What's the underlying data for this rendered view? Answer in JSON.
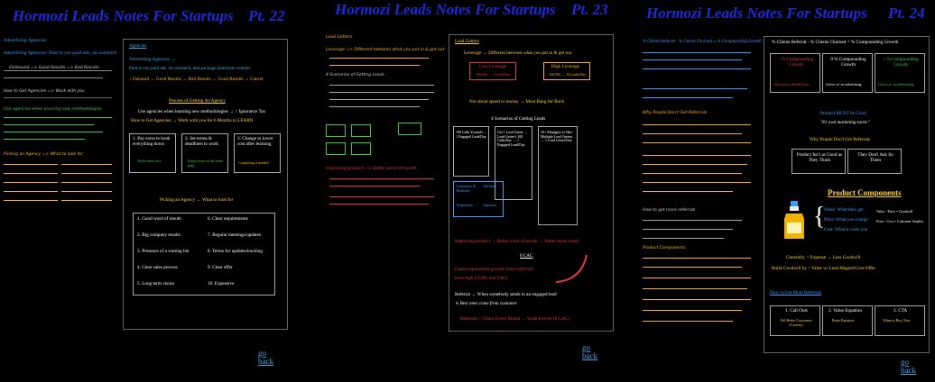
{
  "columns": [
    {
      "title": "Hormozi Leads Notes For Startups",
      "part": "Pt. 22",
      "go_back": "go back",
      "handwritten_notes": [
        "Advertising Agencies",
        "Advertising Agencies: Paid to run paid ads, do outreach",
        "Outbound => Good Results => Bad Results",
        "How to Get Agencies => Work with you",
        "Use agencies when learning new methodologies",
        "Picking an Agency => What to look for"
      ],
      "panel": {
        "heading": "Agencies",
        "lines": [
          "Advertising Agencies →",
          "Paid to run paid ads, do outreach, and package distribute content",
          "↓ Onboard → Good Results → Bad Results → Good Results → Cancel"
        ],
        "process_heading": "Process of Getting An Agency",
        "process_line1": "Use agencies when learning new methodologies → ↑ Ignorance Tax",
        "process_line2": "How to Get Agencies → Work with you for 6 Months to LEARN",
        "steps": [
          {
            "label": "1. Pay extra to book everything down",
            "sub": "Teach team once"
          },
          {
            "label": "2. Set terms & deadlines to work",
            "sub": "Keeps team on the same page"
          },
          {
            "label": "3. Change to lower cost after learning",
            "sub": "Consulting if needed"
          }
        ],
        "picking_line": "Picking an Agency → What to look for",
        "criteria": [
          "1. Good word of mouth",
          "6. Clear requirements",
          "2. Big company results",
          "7. Regular meetings/updates",
          "3. Presence of a waiting list",
          "8. Terms for updates/tracking",
          "4. Clear sales process",
          "9. Clear offer",
          "5. Long term vision",
          "10. Expensive"
        ]
      }
    },
    {
      "title": "Hormozi Leads Notes For Startups",
      "part": "Pt. 23",
      "go_back": "go back",
      "handwritten_notes": [
        "Lead Getters",
        "Leverage => Different between what you put in & get out",
        "4 Scenarios of Getting Leads",
        "Improving product => Better word of mouth"
      ],
      "panel": {
        "heading": "Lead Getters",
        "leverage_line": "Leverage → Different between what you put in & get out",
        "low_leverage": "Low Leverage",
        "low_leverage_sub": "1Hr/Wk → 1 Lead/Day",
        "high_leverage": "High Leverage",
        "high_leverage_sub": "1Hr/Wk → 1k Leads/Day",
        "not_about_line": "Not about speed or money → Most Bang for Buck",
        "scenarios_heading": "4 Scenarios of Getting Leads",
        "scenarios": [
          "100 Calls Yourself → 1 Engaged Lead/Day",
          "Get 1 Lead Getter → Lead Getter's 100 Calls/Day → 1 Engaged Lead/Day",
          "10+ Managers to Hire Multiple Lead Getters → 1 Lead Getter/Day"
        ],
        "affiliates": [
          "Customers & Referrals",
          "Affiliates",
          "Employees",
          "Agencies"
        ],
        "improving_line": "Improving product → Better word of mouth → Better more Leads",
        "cac_label": "0 CAC",
        "cause_line": "Cause exponential growth, since referrals",
        "cause_line2": "have high LTGPs and CACs",
        "referral_line": "Referral → When somebody sends in an engaged lead",
        "referral_sub": "↳ Best ones come from customer",
        "footer_line": "Referrals > Churn Every Month → Scale forever (0 CAC)"
      }
    },
    {
      "title": "Hormozi Leads Notes For Startups",
      "part": "Pt. 24",
      "go_back": "go back",
      "handwritten_notes": [
        "% Clients Referral - % Clients Churned = % Compounding Growth",
        "Why People Don't Get Referrals",
        "How to get more referrals",
        "Product Components"
      ],
      "panel": {
        "top_line": "% Clients Referral - % Clients Churned = % Compounding Growth",
        "growth_cells": [
          {
            "label": "- % Compounding Growth",
            "sub": "Advertise to Break Even",
            "color": "#e23b3b"
          },
          {
            "label": "0 % Compounding Growth",
            "sub": "Grows w/ no advertising",
            "color": "#ffffff"
          },
          {
            "label": "+ % Compounding Growth",
            "sub": "Grows w/ no advertising",
            "color": "#3ec93e"
          }
        ],
        "must_be_good": "Product MUST be Good",
        "quote": "\"#1 own marketing tactic\"",
        "why_heading": "Why People Don't Get Referrals",
        "why_cells": [
          "Product Isn't as Good as They Think",
          "They Don't Ask So Them"
        ],
        "product_components": "Product Components",
        "value_line": "Value: What they get",
        "price_line": "Price: What you charge",
        "cost_line": "Cost: What it costs you",
        "value_minus": "Value - Price = Goodwill",
        "price_minus": "Price - Cost = Customer Surplus",
        "generally": "Generally, ↑ Expense → Less Goodwill",
        "build_goodwill": "Build Goodwill by ↑ Value w/ Lead Magnet/Core Offer",
        "how_more": "How to Get More Referrals",
        "how_cells": [
          {
            "label": "1. Call Outs",
            "sub": "Tell Better Customers (Crosses)"
          },
          {
            "label": "2. Value Equation",
            "sub": "Raise Equation"
          },
          {
            "label": "3. CTA",
            "sub": "When to Buy, Now"
          }
        ]
      }
    }
  ],
  "colors": {
    "title_blue": "#1c2bd6",
    "link_blue": "#4aa3df",
    "panel_heading": "#ffd23a",
    "accent_red": "#e23b3b",
    "accent_green": "#3ec93e"
  }
}
